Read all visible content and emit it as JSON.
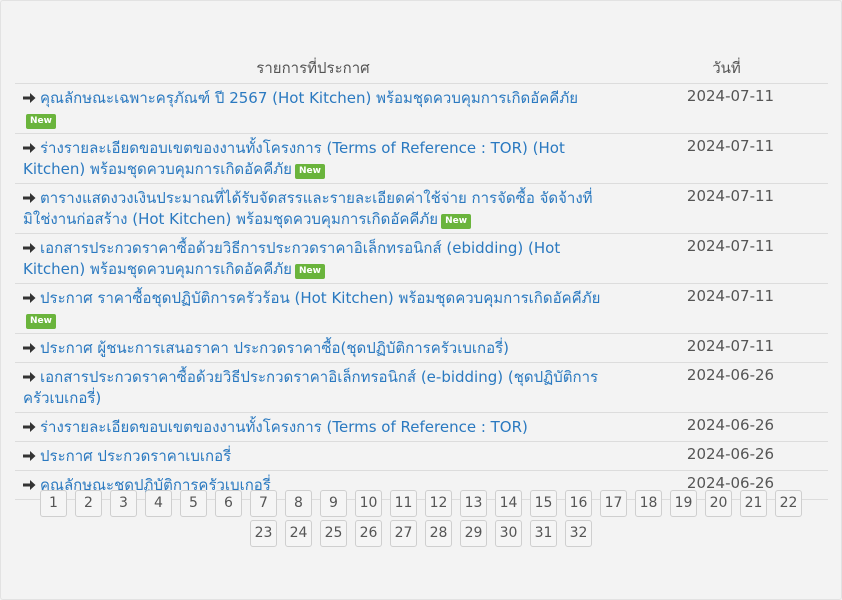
{
  "header": {
    "title_col": "รายการที่ประกาศ",
    "date_col": "วันที่"
  },
  "rows": [
    {
      "text": "คุณลักษณะเฉพาะครุภัณฑ์ ปี 2567 (Hot Kitchen) พร้อมชุดควบคุมการเกิดอัคคีภัย",
      "badge": "New",
      "date": "2024-07-11"
    },
    {
      "text": "ร่างรายละเอียดขอบเขตของงานทั้งโครงการ (Terms of Reference : TOR) (Hot Kitchen) พร้อมชุดควบคุมการเกิดอัคคีภัย",
      "badge": "New",
      "date": "2024-07-11"
    },
    {
      "text": "ตารางแสดงวงเงินประมาณที่ได้รับจัดสรรและรายละเอียดค่าใช้จ่าย การจัดซื้อ จัดจ้างที่มิใช่งานก่อสร้าง (Hot Kitchen) พร้อมชุดควบคุมการเกิดอัคคีภัย",
      "badge": "New",
      "date": "2024-07-11"
    },
    {
      "text": "เอกสารประกวดราคาซื้อด้วยวิธีการประกวดราคาอิเล็กทรอนิกส์ (ebidding) (Hot Kitchen) พร้อมชุดควบคุมการเกิดอัคคีภัย",
      "badge": "New",
      "date": "2024-07-11"
    },
    {
      "text": "ประกาศ ราคาซื้อชุดปฏิบัติการครัวร้อน (Hot Kitchen) พร้อมชุดควบคุมการเกิดอัคคีภัย",
      "badge": "New",
      "date": "2024-07-11"
    },
    {
      "text": "ประกาศ ผู้ชนะการเสนอราคา ประกวดราคาซื้อ(ชุดปฏิบัติการครัวเบเกอรี่)",
      "badge": "",
      "date": "2024-07-11"
    },
    {
      "text": "เอกสารประกวดราคาซื้อด้วยวิธีประกวดราคาอิเล็กทรอนิกส์ (e-bidding) (ชุดปฏิบัติการครัวเบเกอรี่)",
      "badge": "",
      "date": "2024-06-26"
    },
    {
      "text": "ร่างรายละเอียดขอบเขตของงานทั้งโครงการ (Terms of Reference : TOR)",
      "badge": "",
      "date": "2024-06-26"
    },
    {
      "text": "ประกาศ ประกวดราคาเบเกอรี่",
      "badge": "",
      "date": "2024-06-26"
    },
    {
      "text": "คุณลักษณะชุดปฏิบัติการครัวเบเกอรี่",
      "badge": "",
      "date": "2024-06-26"
    }
  ],
  "pagination": [
    "1",
    "2",
    "3",
    "4",
    "5",
    "6",
    "7",
    "8",
    "9",
    "10",
    "11",
    "12",
    "13",
    "14",
    "15",
    "16",
    "17",
    "18",
    "19",
    "20",
    "21",
    "22",
    "23",
    "24",
    "25",
    "26",
    "27",
    "28",
    "29",
    "30",
    "31",
    "32"
  ],
  "colors": {
    "link": "#2a79c0",
    "badge": "#6ab43c",
    "arrow": "#333333"
  },
  "icons": {
    "row_icon": "arrow-right-icon"
  }
}
